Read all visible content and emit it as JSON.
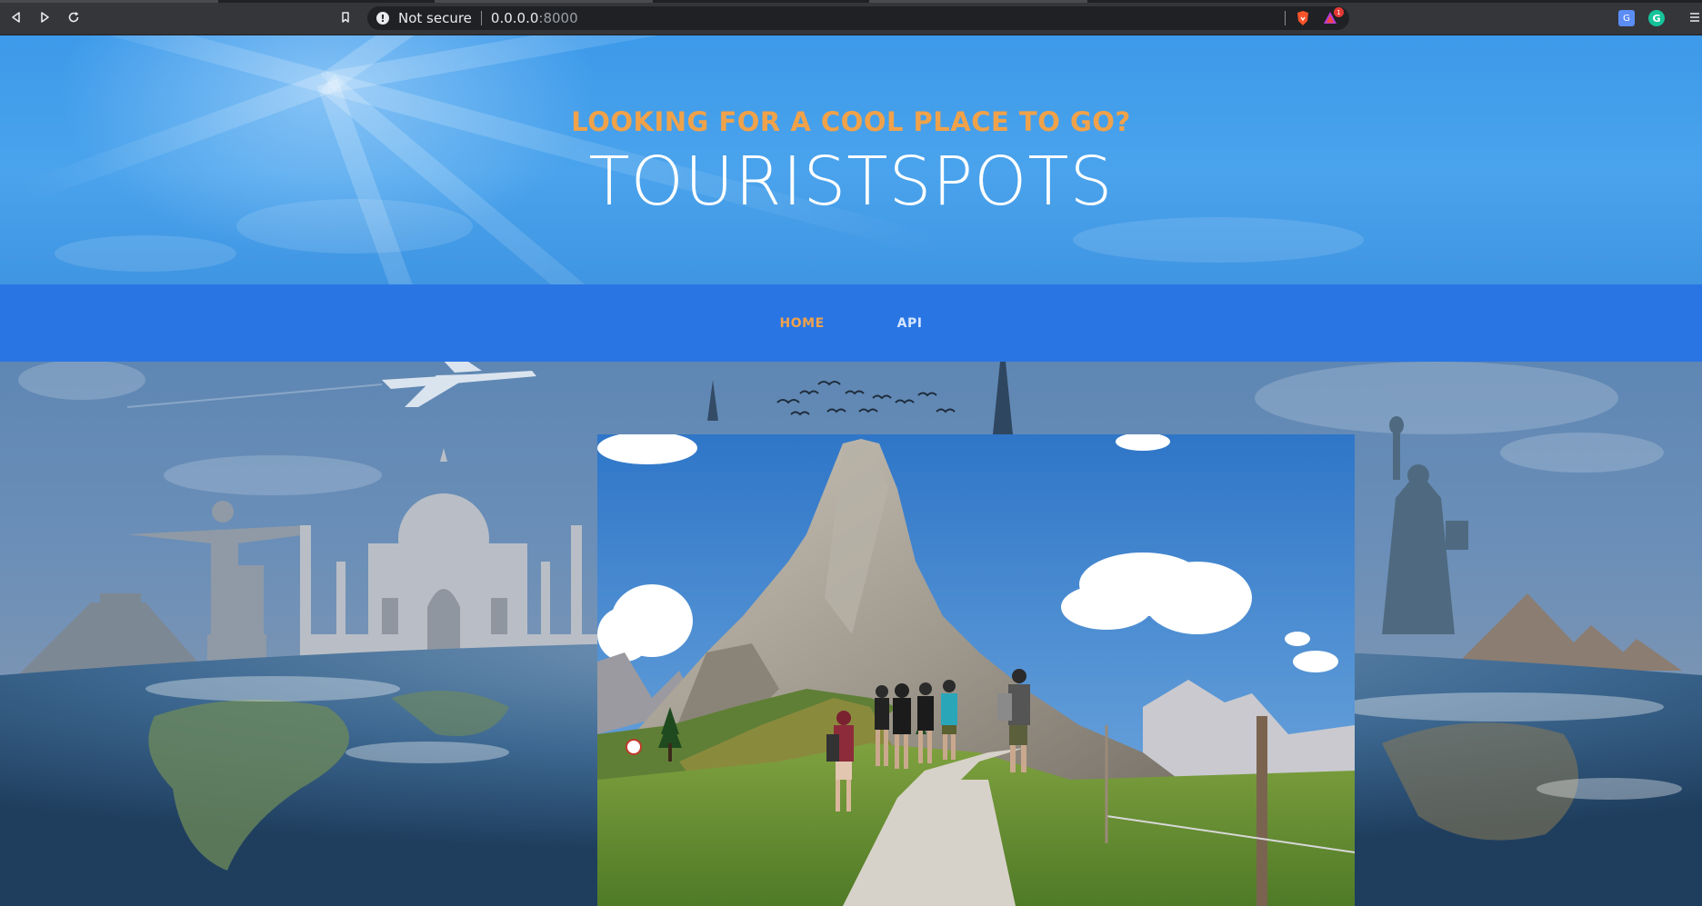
{
  "browser": {
    "security_label": "Not secure",
    "url_host": "0.0.0.0",
    "url_port": ":8000",
    "rewards_badge": "1",
    "translate_label": "G",
    "grammarly_label": "G"
  },
  "hero": {
    "kicker": "LOOKING FOR A COOL PLACE TO GO?",
    "title": "TOURISTSPOTS"
  },
  "nav": {
    "home_label": "HOME",
    "api_label": "API",
    "active": "HOME"
  },
  "colors": {
    "accent_orange": "#f0a24a",
    "nav_blue": "#2a75e4",
    "hero_blue": "#4aa3ec"
  },
  "images": {
    "background": "world-landmarks-collage",
    "featured": "mountain-hikers-photo"
  }
}
